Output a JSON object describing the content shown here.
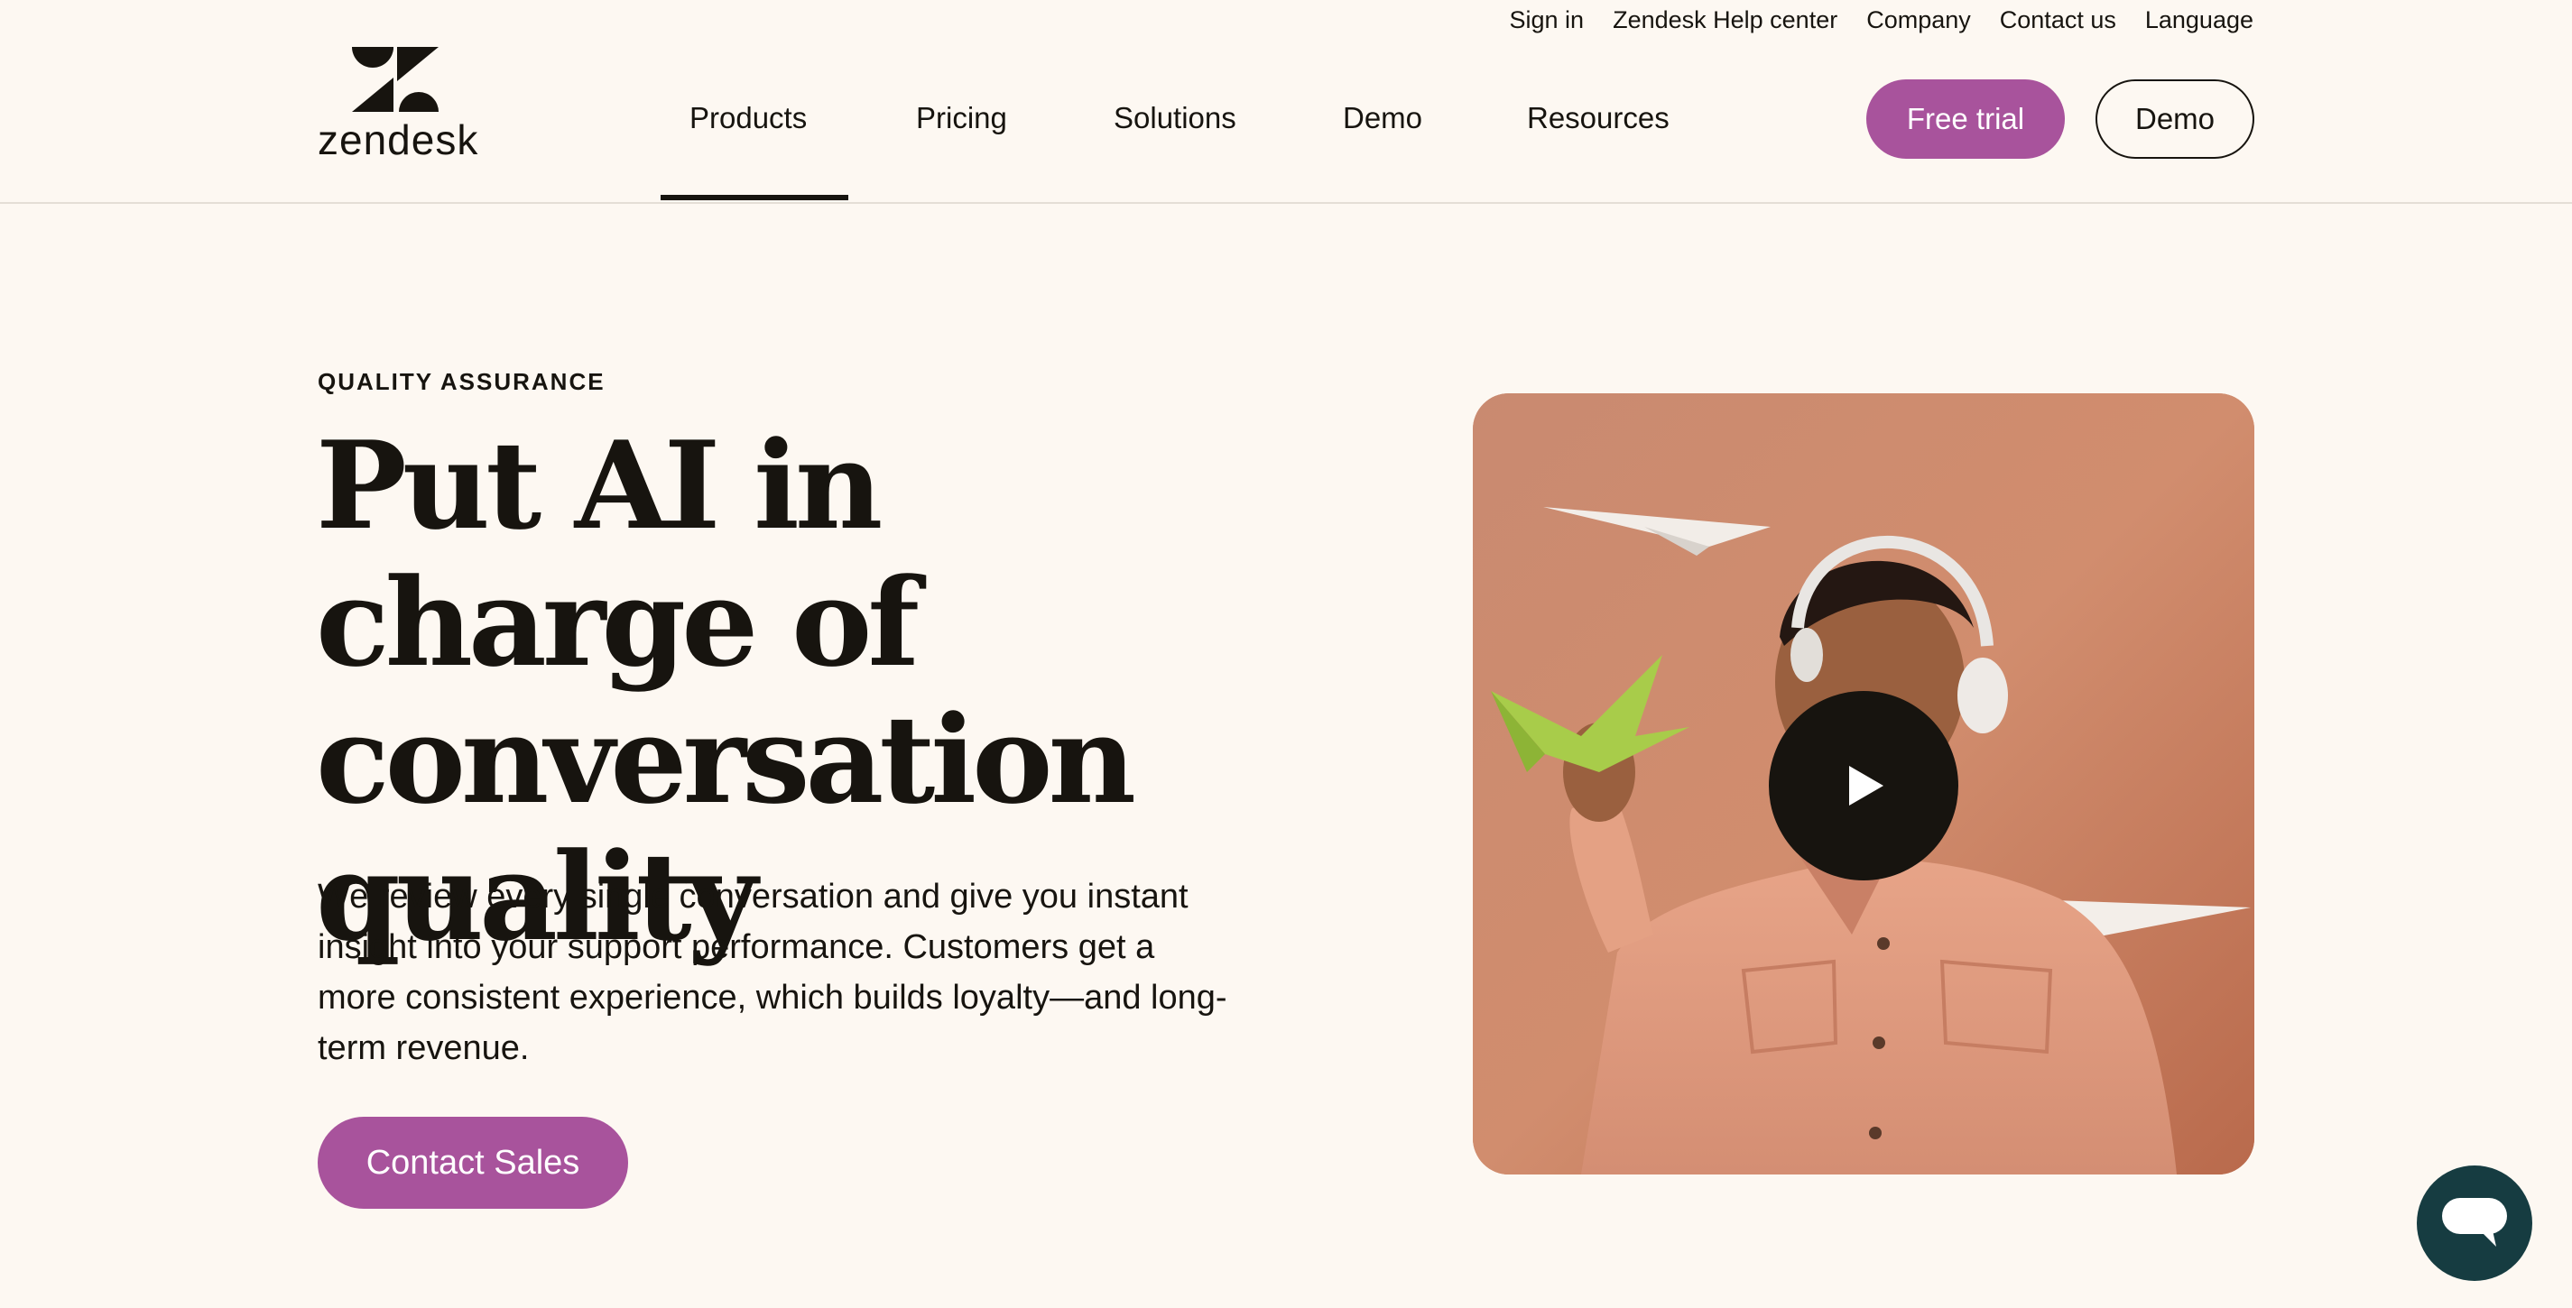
{
  "utility_nav": {
    "sign_in": "Sign in",
    "help_center": "Zendesk Help center",
    "company": "Company",
    "contact_us": "Contact us",
    "language": "Language"
  },
  "logo": {
    "wordmark": "zendesk",
    "icon": "zendesk-logo-icon"
  },
  "main_nav": {
    "items": [
      {
        "label": "Products",
        "active": true
      },
      {
        "label": "Pricing",
        "active": false
      },
      {
        "label": "Solutions",
        "active": false
      },
      {
        "label": "Demo",
        "active": false
      },
      {
        "label": "Resources",
        "active": false
      }
    ],
    "free_trial_label": "Free trial",
    "demo_label": "Demo"
  },
  "hero": {
    "eyebrow": "QUALITY ASSURANCE",
    "title": "Put AI in charge of conversation quality",
    "body": "We review every single conversation and give you instant insight into your support performance. Customers get a more consistent experience, which builds loyalty—and long-term revenue.",
    "cta_label": "Contact Sales"
  },
  "video": {
    "play_icon": "play-icon"
  },
  "chat_widget": {
    "icon": "chat-bubble-icon"
  },
  "colors": {
    "background": "#fdf8f2",
    "brand_purple": "#a8539c",
    "text_dark": "#17140f",
    "chat_teal": "#163c41",
    "video_bg": "#cf8a6c"
  }
}
